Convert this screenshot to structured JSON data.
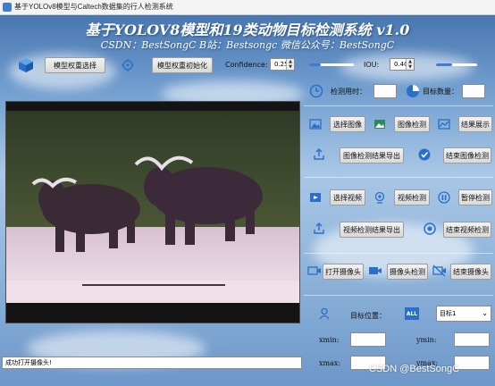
{
  "window": {
    "title": "基于YOLOv8模型与Caltech数据集的行人检测系统"
  },
  "header": {
    "title": "基于YOLOV8模型和19类动物目标检测系统 v1.0",
    "subtitle": "CSDN：BestSongC   B站：Bestsongc   微信公众号：BestSongC"
  },
  "toolbar": {
    "select_weights_label": "模型权重选择",
    "init_weights_label": "模型权重初始化",
    "confidence_label": "Confidence:",
    "confidence_value": "0.25",
    "confidence_level": 0.25,
    "iou_label": "IOU:",
    "iou_value": "0.40",
    "iou_level": 0.4
  },
  "stats": {
    "time_label": "检测用时：",
    "count_label": "目标数量："
  },
  "image_section": {
    "select_image": "选择图像",
    "detect_image": "图像检测",
    "show_result": "结果展示",
    "export_result": "图像检测结果导出",
    "stop_image": "结束图像检测"
  },
  "video_section": {
    "select_video": "选择视频",
    "detect_video": "视频检测",
    "pause": "暂停检测",
    "export_result": "视频检测结果导出",
    "stop_video": "结束视频检测"
  },
  "camera_section": {
    "open_camera": "打开摄像头",
    "detect_camera": "摄像头检测",
    "stop_camera": "结束摄像头"
  },
  "target": {
    "position_label": "目标位置：",
    "all_badge": "ALL",
    "selected": "目标1",
    "xmin_label": "xmin:",
    "ymin_label": "ymin:",
    "xmax_label": "xmax:",
    "ymax_label": "ymax:"
  },
  "status": {
    "message": "成功打开摄像头!"
  },
  "watermark": "CSDN @BestSongC",
  "colors": {
    "accent": "#3d7bd9",
    "title_text": "#ffffff"
  }
}
